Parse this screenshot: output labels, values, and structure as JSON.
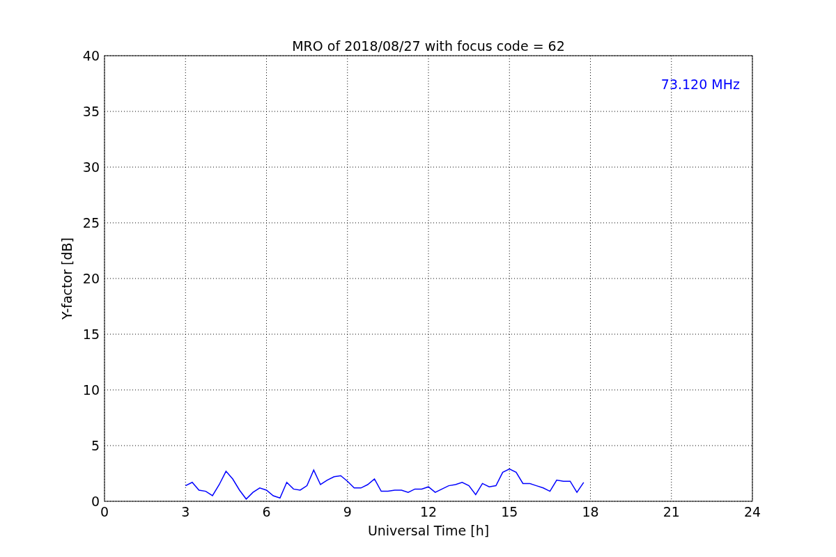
{
  "chart_data": {
    "type": "line",
    "title": "MRO of 2018/08/27 with focus code = 62",
    "xlabel": "Universal Time [h]",
    "ylabel": "Y-factor [dB]",
    "xlim": [
      0,
      24
    ],
    "ylim": [
      0,
      40
    ],
    "xticks": [
      0,
      3,
      6,
      9,
      12,
      15,
      18,
      21,
      24
    ],
    "yticks": [
      0,
      5,
      10,
      15,
      20,
      25,
      30,
      35,
      40
    ],
    "x": [
      3.0,
      3.25,
      3.5,
      3.75,
      4.0,
      4.25,
      4.5,
      4.75,
      5.0,
      5.25,
      5.5,
      5.75,
      6.0,
      6.25,
      6.5,
      6.75,
      7.0,
      7.25,
      7.5,
      7.75,
      8.0,
      8.25,
      8.5,
      8.75,
      9.0,
      9.25,
      9.5,
      9.75,
      10.0,
      10.25,
      10.5,
      10.75,
      11.0,
      11.25,
      11.5,
      11.75,
      12.0,
      12.25,
      12.5,
      12.75,
      13.0,
      13.25,
      13.5,
      13.75,
      14.0,
      14.25,
      14.5,
      14.75,
      15.0,
      15.25,
      15.5,
      15.75,
      16.0,
      16.25,
      16.5,
      16.75,
      17.0,
      17.25,
      17.5,
      17.75
    ],
    "grid": true,
    "series": [
      {
        "color": "#0000ff",
        "values": [
          1.4,
          1.7,
          1.0,
          0.9,
          0.5,
          1.5,
          2.7,
          2.0,
          1.0,
          0.2,
          0.8,
          1.2,
          1.0,
          0.5,
          0.3,
          1.7,
          1.1,
          1.0,
          1.4,
          2.8,
          1.5,
          1.9,
          2.2,
          2.3,
          1.8,
          1.2,
          1.2,
          1.5,
          2.0,
          0.9,
          0.9,
          1.0,
          1.0,
          0.8,
          1.1,
          1.1,
          1.3,
          0.8,
          1.1,
          1.4,
          1.5,
          1.7,
          1.4,
          0.6,
          1.6,
          1.3,
          1.4,
          2.6,
          2.9,
          2.6,
          1.6,
          1.6,
          1.4,
          1.2,
          0.9,
          1.9,
          1.8,
          1.8,
          0.8,
          1.7
        ]
      }
    ],
    "annotations": [
      {
        "text": "73.120 MHz"
      }
    ]
  }
}
